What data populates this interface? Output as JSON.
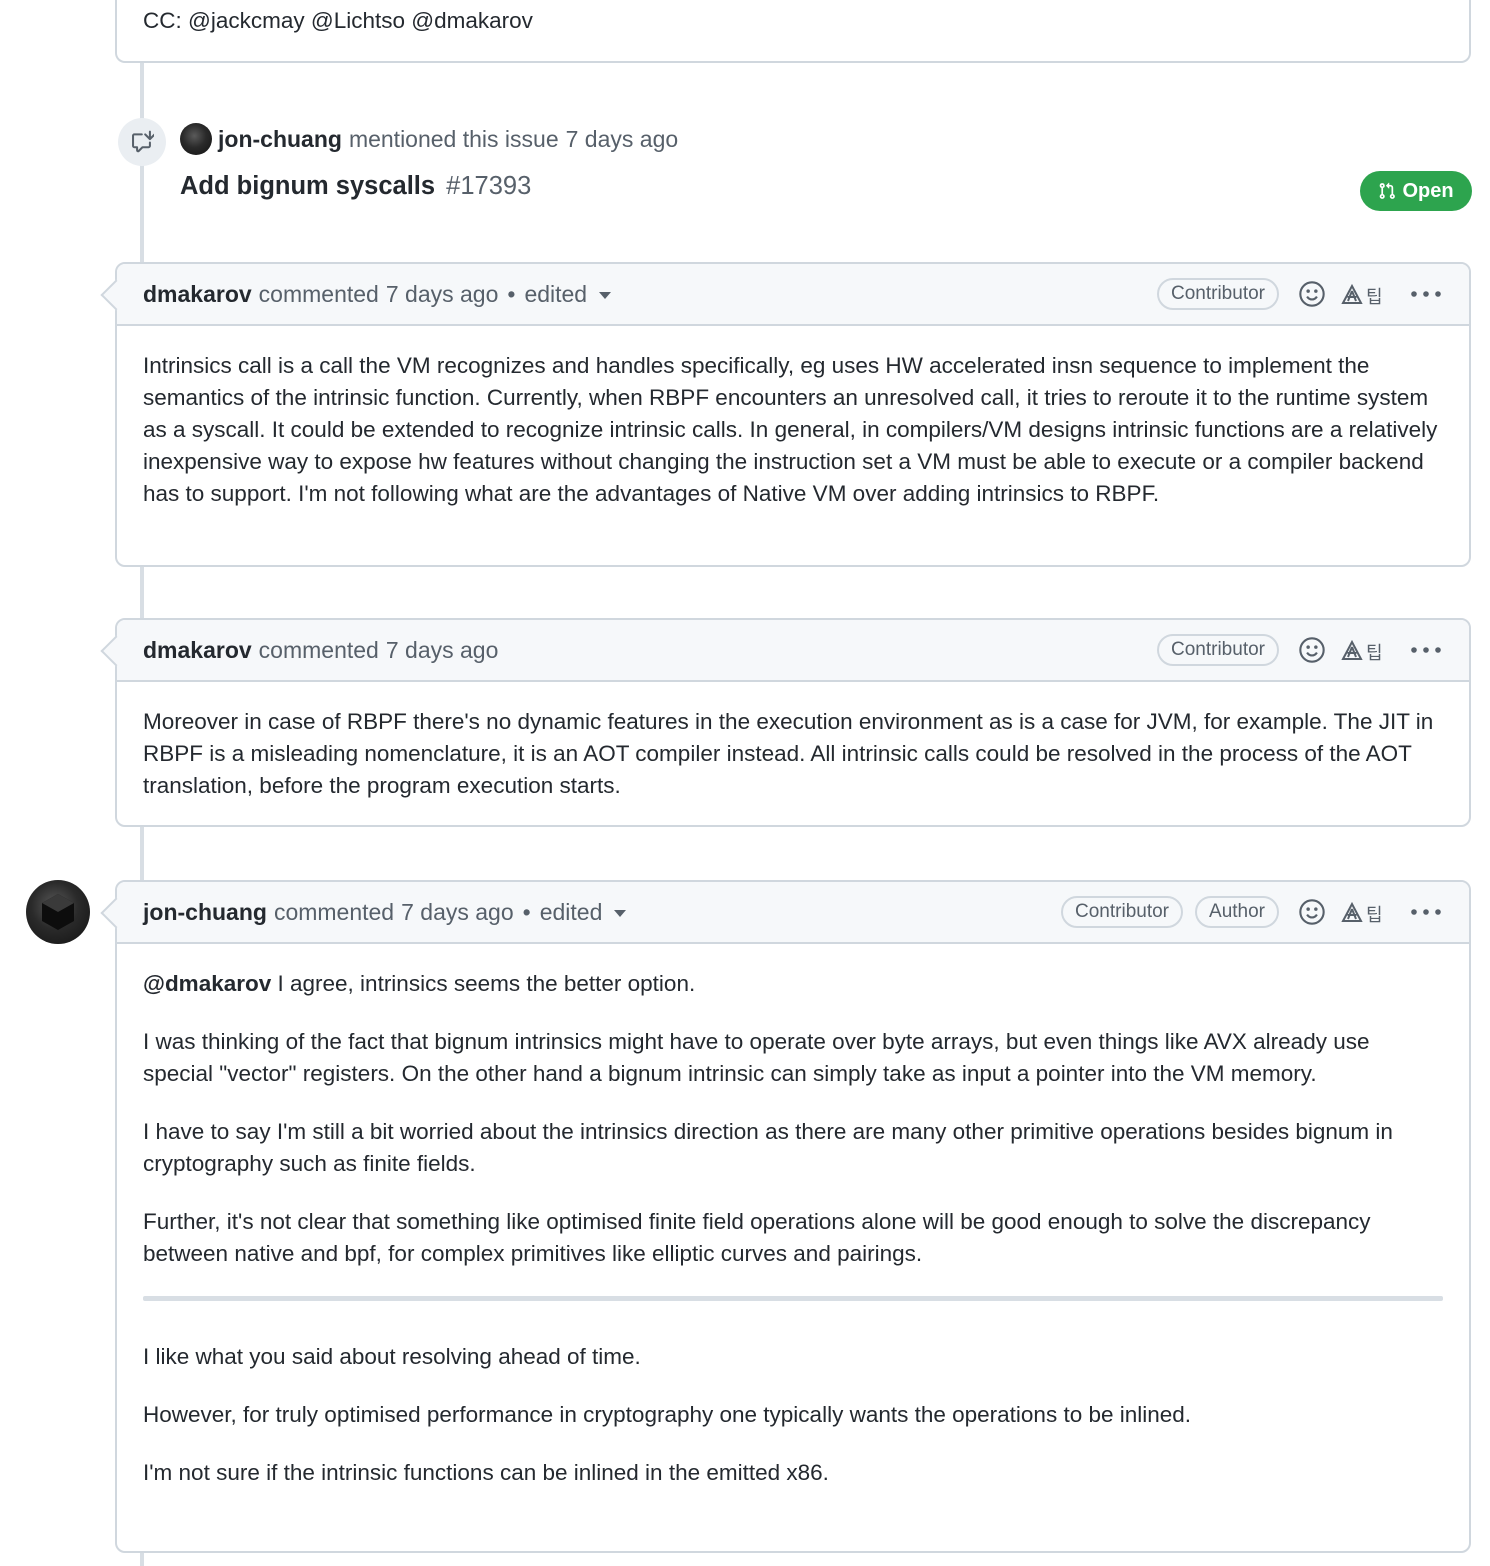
{
  "top_comment": {
    "cc_text": "CC: @jackcmay @Lichtso @dmakarov"
  },
  "event": {
    "user": "jon-chuang",
    "action": "mentioned this issue",
    "time": "7 days ago",
    "pr_title": "Add bignum syscalls",
    "pr_number": "#17393",
    "status_label": "Open"
  },
  "comments": [
    {
      "author": "dmakarov",
      "verb": "commented",
      "time": "7 days ago",
      "edited_dot": "•",
      "edited": "edited",
      "badges": [
        "Contributor"
      ],
      "paragraphs": [
        "Intrinsics call is a call the VM recognizes and handles specifically, eg uses HW accelerated insn sequence to implement the semantics of the intrinsic function. Currently, when RBPF encounters an unresolved call, it tries to reroute it to the runtime system as a syscall. It could be extended to recognize intrinsic calls. In general, in compilers/VM designs intrinsic functions are a relatively inexpensive way to expose hw features without changing the instruction set a VM must be able to execute or a compiler backend has to support. I'm not following what are the advantages of Native VM over adding intrinsics to RBPF."
      ]
    },
    {
      "author": "dmakarov",
      "verb": "commented",
      "time": "7 days ago",
      "badges": [
        "Contributor"
      ],
      "paragraphs": [
        "Moreover in case of RBPF there's no dynamic features in the execution environment as is a case for JVM, for example. The JIT in RBPF is a misleading nomenclature, it is an AOT compiler instead. All intrinsic calls could be resolved in the process of the AOT translation, before the program execution starts."
      ]
    },
    {
      "author": "jon-chuang",
      "verb": "commented",
      "time": "7 days ago",
      "edited_dot": "•",
      "edited": "edited",
      "badges": [
        "Contributor",
        "Author"
      ],
      "mention": "@dmakarov",
      "first_rest": " I agree, intrinsics seems the better option.",
      "paragraphs": [
        "I was thinking of the fact that bignum intrinsics might have to operate over byte arrays, but even things like AVX already use special \"vector\" registers. On the other hand a bignum intrinsic can simply take as input a pointer into the VM memory.",
        "I have to say I'm still a bit worried about the intrinsics direction as there are many other primitive operations besides bignum in cryptography such as finite fields.",
        "Further, it's not clear that something like optimised finite field operations alone will be good enough to solve the discrepancy between native and bpf, for complex primitives like elliptic curves and pairings."
      ],
      "paragraphs_after_rule": [
        "I like what you said about resolving ahead of time.",
        "However, for truly optimised performance in cryptography one typically wants the operations to be inlined.",
        "I'm not sure if the intrinsic functions can be inlined in the emitted x86."
      ]
    }
  ],
  "icons": {
    "reaction": "smiley-icon",
    "translate": "translate-icon",
    "menu": "kebab-horizontal-icon",
    "cross_reference": "cross-reference-icon",
    "pull_request": "git-pull-request-icon"
  },
  "colors": {
    "open_green": "#2da44e",
    "border": "#d0d7de",
    "header_bg": "#f6f8fa",
    "muted_text": "#57606a"
  }
}
